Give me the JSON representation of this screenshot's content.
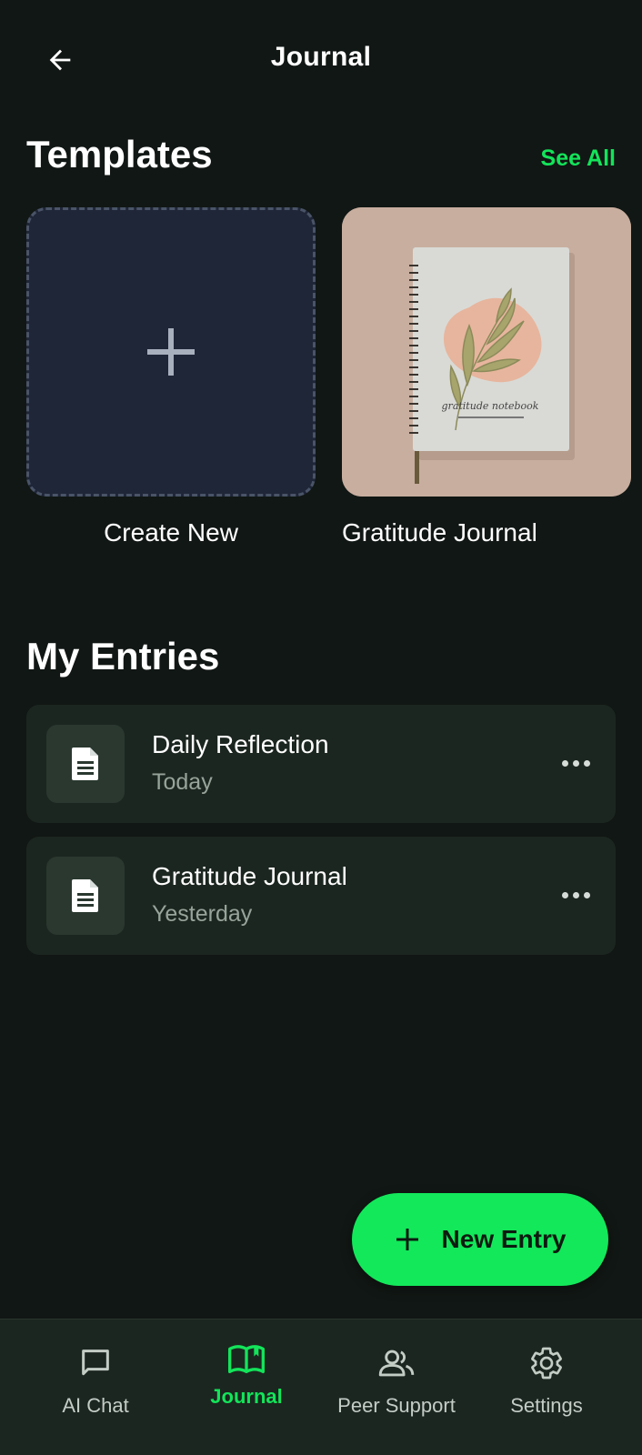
{
  "header": {
    "title": "Journal",
    "back_icon": "arrow-left-icon"
  },
  "templates": {
    "title": "Templates",
    "see_all": "See All",
    "items": [
      {
        "label": "Create New",
        "icon": "plus-icon"
      },
      {
        "label": "Gratitude Journal",
        "image": "gratitude-notebook-image",
        "cover_text": "gratitude notebook"
      }
    ]
  },
  "entries": {
    "title": "My Entries",
    "items": [
      {
        "title": "Daily Reflection",
        "date": "Today",
        "icon": "document-icon"
      },
      {
        "title": "Gratitude Journal",
        "date": "Yesterday",
        "icon": "document-icon"
      }
    ]
  },
  "fab": {
    "label": "New Entry",
    "icon": "plus-icon"
  },
  "nav": {
    "active": "Journal",
    "items": [
      {
        "label": "AI Chat",
        "icon": "chat-bubble-icon"
      },
      {
        "label": "Journal",
        "icon": "open-book-icon"
      },
      {
        "label": "Peer Support",
        "icon": "people-icon"
      },
      {
        "label": "Settings",
        "icon": "gear-icon"
      }
    ]
  },
  "colors": {
    "background": "#111714",
    "accent": "#13e45a",
    "card": "#1c2620",
    "create_card": "#1f2638"
  }
}
